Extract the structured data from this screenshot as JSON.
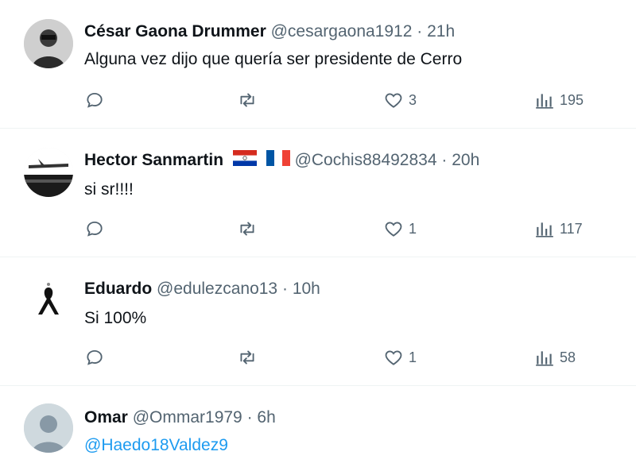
{
  "replies": [
    {
      "name": "César Gaona Drummer",
      "handle": "@cesargaona1912",
      "dot": "·",
      "time": "21h",
      "text": "Alguna vez dijo que quería ser presidente de Cerro",
      "likes": "3",
      "views": "195",
      "avatar_icon": "person-photo"
    },
    {
      "name": "Hector Sanmartin",
      "handle": "@Cochis88492834",
      "dot": "·",
      "time": "20h",
      "text": "si sr!!!!",
      "likes": "1",
      "views": "117",
      "flags": [
        "paraguay-flag-icon",
        "france-flag-icon"
      ],
      "avatar_icon": "plane-photo"
    },
    {
      "name": "Eduardo",
      "handle": "@edulezcano13",
      "dot": "·",
      "time": "10h",
      "text": "Si 100%",
      "likes": "1",
      "views": "58",
      "avatar_icon": "mourning-ribbon"
    },
    {
      "name": "Omar",
      "handle": "@Ommar1979",
      "dot": "·",
      "time": "6h",
      "text": "@Haedo18Valdez9",
      "avatar_icon": "default-avatar"
    }
  ],
  "colors": {
    "text": "#0f1419",
    "secondary": "#536471",
    "link": "#1d9bf0",
    "divider": "#eff3f4"
  }
}
